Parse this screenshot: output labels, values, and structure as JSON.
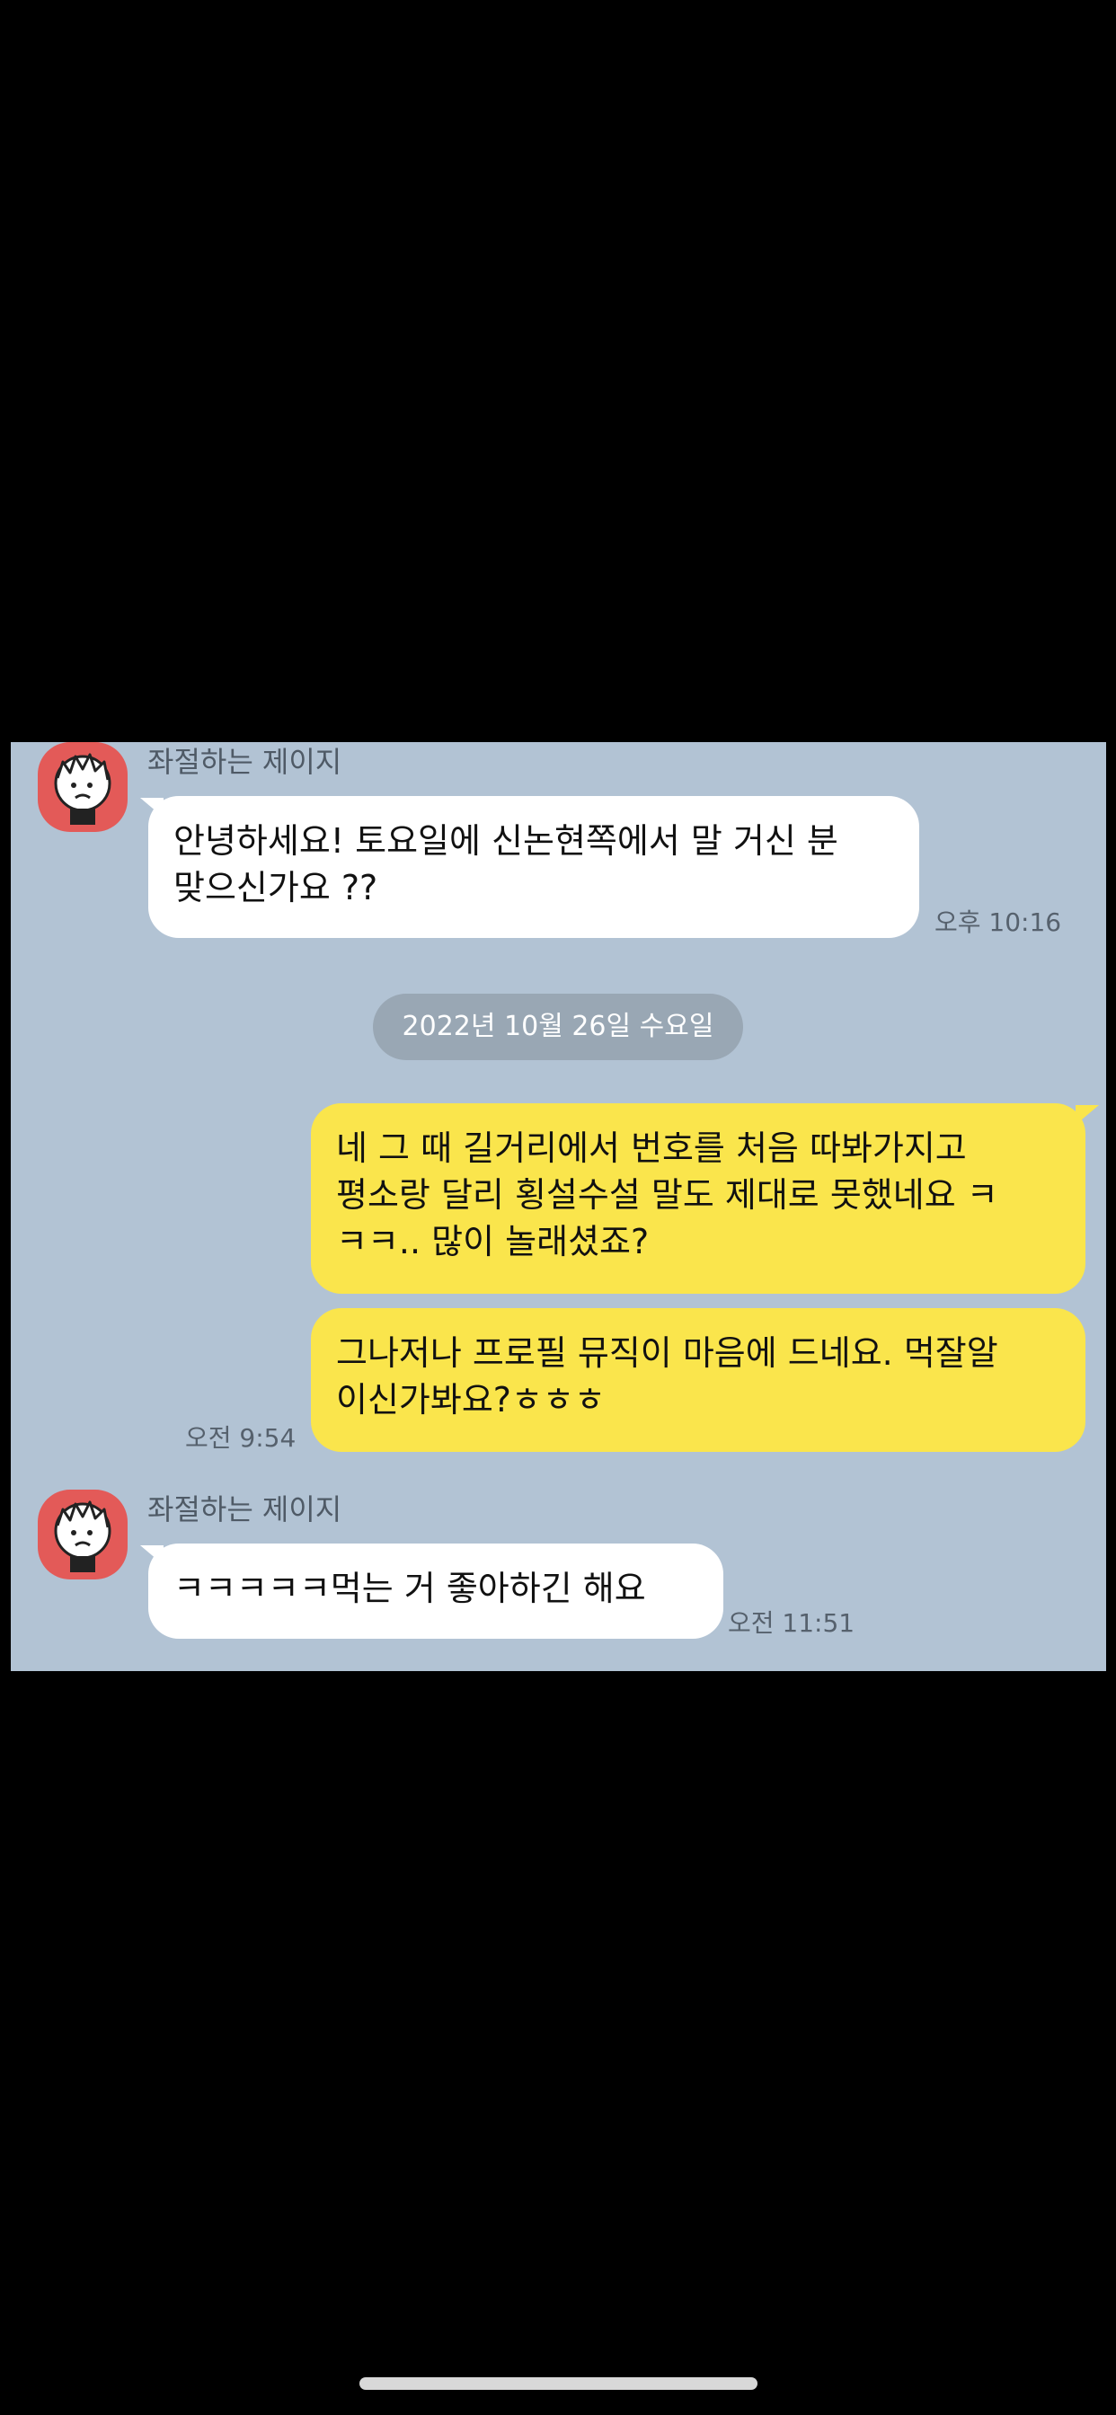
{
  "conversation": {
    "first_block": {
      "sender_name": "좌절하는 제이지",
      "message": "안녕하세요! 토요일에 신논현쪽에서 말 거신 분\n맞으신가요 ??",
      "time": "오후 10:16"
    },
    "date_divider": "2022년 10월 26일 수요일",
    "my_messages": [
      "네 그 때 길거리에서 번호를 처음 따봐가지고\n평소랑 달리 횡설수설 말도 제대로 못했네요 ㅋ\nㅋㅋ.. 많이 놀래셨죠?",
      "그나저나 프로필 뮤직이 마음에 드네요. 먹잘알\n이신가봐요?ㅎㅎㅎ"
    ],
    "my_time": "오전 9:54",
    "second_block": {
      "sender_name": "좌절하는 제이지",
      "message": "ㅋㅋㅋㅋㅋ먹는 거 좋아하긴 해요",
      "time": "오전 11:51"
    }
  },
  "colors": {
    "chat_background": "#b2c3d4",
    "my_bubble": "#fae54c",
    "their_bubble": "#ffffff",
    "avatar_background": "#e35a58",
    "date_pill": "#99a7b4"
  },
  "icons": {
    "avatar": "cartoon-character-avatar",
    "home_indicator": "home-bar"
  }
}
